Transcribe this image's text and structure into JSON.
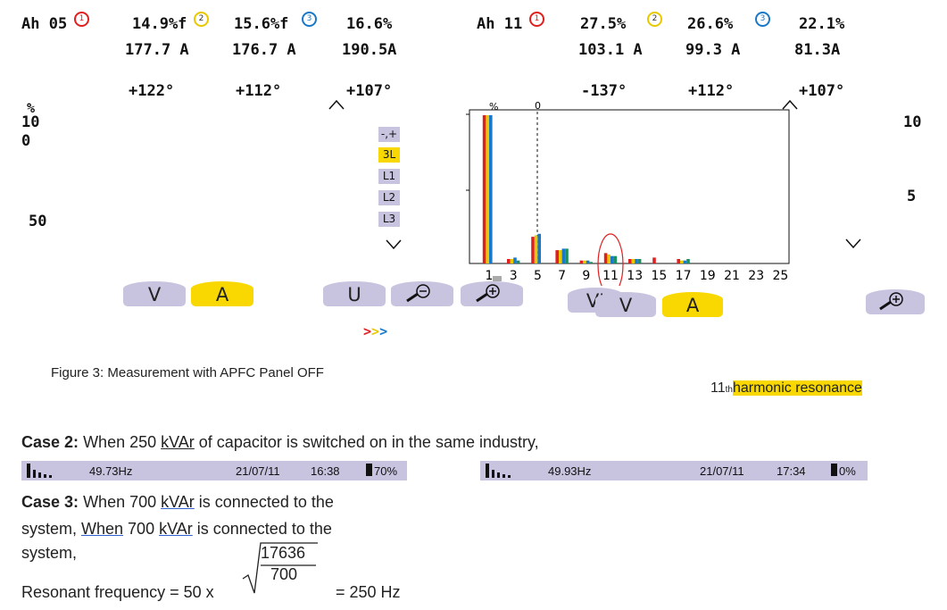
{
  "left_panel": {
    "label": "Ah 05",
    "phase_ids": [
      "1",
      "2",
      "3"
    ],
    "pct": [
      "14.9%f",
      "15.6%f",
      "16.6%"
    ],
    "amps": [
      "177.7 A",
      "176.7 A",
      "190.5A"
    ],
    "angles": [
      "+122°",
      "+112°",
      "+107°"
    ],
    "scale": {
      "unit": "%",
      "top": "10",
      "zero": "0",
      "mid": "50"
    },
    "side_menu": [
      "-,+",
      "3L",
      "L1",
      "L2",
      "L3"
    ],
    "side_menu_active": "3L",
    "buttons": {
      "v": "V",
      "a": "A",
      "u": "U"
    },
    "arrows": [
      ">",
      ">",
      ">"
    ],
    "arrow_colors": [
      "#e02020",
      "#e8c800",
      "#1a78c8"
    ]
  },
  "right_panel": {
    "label": "Ah 11",
    "phase_ids": [
      "1",
      "2",
      "3"
    ],
    "pct": [
      "27.5%",
      "26.6%",
      "22.1%"
    ],
    "amps": [
      "103.1 A",
      "99.3 A",
      "81.3A"
    ],
    "angles": [
      "-137°",
      "+112°",
      "+107°"
    ],
    "scale_right": [
      "10",
      "5"
    ],
    "buttons": {
      "v_partial": "V'",
      "v": "V",
      "a": "A"
    }
  },
  "chart_data": {
    "type": "bar",
    "title": "",
    "ylabel": "%",
    "cursor_label": "0",
    "categories": [
      "1",
      "3",
      "5",
      "7",
      "9",
      "11",
      "13",
      "15",
      "17",
      "19",
      "21",
      "23",
      "25"
    ],
    "x_ticks": [
      "1",
      "3",
      "5",
      "7",
      "9",
      "11",
      "13",
      "15",
      "17",
      "19",
      "21",
      "23",
      "25"
    ],
    "ylim": [
      0,
      10
    ],
    "series_colors": [
      "#e02020",
      "#e8c800",
      "#1a78c8",
      "#1a9060"
    ],
    "series": [
      {
        "values": [
          10.0,
          0.3,
          1.8,
          0.9,
          0.2,
          0.7,
          0.3,
          0.4,
          0.3,
          0,
          0,
          0,
          0
        ]
      },
      {
        "values": [
          10.0,
          0.3,
          1.9,
          0.9,
          0.2,
          0.6,
          0.3,
          0,
          0.2,
          0,
          0,
          0,
          0
        ]
      },
      {
        "values": [
          10.0,
          0.4,
          2.0,
          1.0,
          0.2,
          0.5,
          0.3,
          0,
          0.2,
          0,
          0,
          0,
          0
        ]
      },
      {
        "values": [
          0,
          0.2,
          0,
          1.0,
          0.1,
          0.5,
          0.3,
          0,
          0.3,
          0,
          0,
          0,
          0
        ]
      }
    ],
    "highlight_category": "11"
  },
  "figure_caption": "Figure 3: Measurement with APFC Panel OFF",
  "annotation": {
    "num": "11",
    "suffix": "th",
    "text": "harmonic resonance"
  },
  "case2": {
    "label": "Case 2:",
    "text_a": "When 250 ",
    "kvar": "kVAr",
    "text_b": " of capacitor is switched on in the same industry,"
  },
  "status_left": {
    "freq": "49.73Hz",
    "date": "21/07/11",
    "time": "16:38",
    "battery": "70%"
  },
  "status_right": {
    "freq": "49.93Hz",
    "date": "21/07/11",
    "time": "17:34",
    "battery": "0%"
  },
  "case3": {
    "label": "Case 3:",
    "line1_a": "When 700 ",
    "line1_kvar": "kVAr",
    "line1_b": " is connected to the",
    "line2_a": "system,  ",
    "line2_when": "When",
    "line2_b": " 700 ",
    "line2_kvar": "kVAr",
    "line2_c": " is connected to the",
    "line3": "system,"
  },
  "formula": {
    "lhs": "Resonant frequency = 50 x",
    "numerator": "17636",
    "denominator": "700",
    "rhs": "= 250 Hz"
  }
}
